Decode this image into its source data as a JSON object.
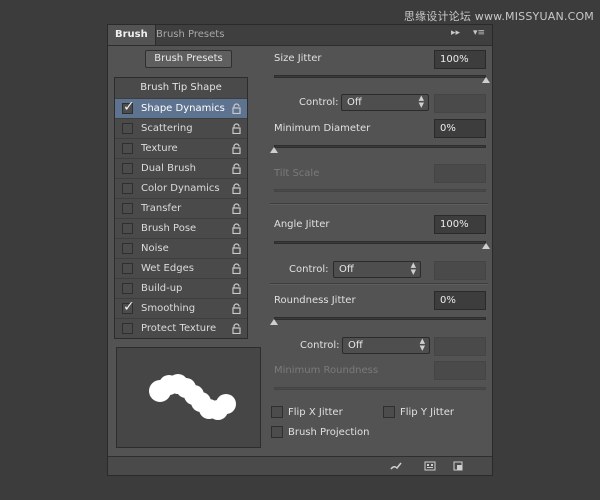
{
  "watermark": "思缘设计论坛 www.MISSYUAN.COM",
  "tabs": [
    "Brush",
    "Brush Presets"
  ],
  "tab_controls": {
    "collapse": "▸▸",
    "menu": "▾≡"
  },
  "presets_button": "Brush Presets",
  "list": {
    "header": "Brush Tip Shape",
    "items": [
      {
        "label": "Shape Dynamics",
        "checked": true,
        "selected": true
      },
      {
        "label": "Scattering",
        "checked": false
      },
      {
        "label": "Texture",
        "checked": false
      },
      {
        "label": "Dual Brush",
        "checked": false
      },
      {
        "label": "Color Dynamics",
        "checked": false
      },
      {
        "label": "Transfer",
        "checked": false
      },
      {
        "label": "Brush Pose",
        "checked": false
      },
      {
        "label": "Noise",
        "checked": false
      },
      {
        "label": "Wet Edges",
        "checked": false
      },
      {
        "label": "Build-up",
        "checked": false
      },
      {
        "label": "Smoothing",
        "checked": true
      },
      {
        "label": "Protect Texture",
        "checked": false
      }
    ]
  },
  "settings": {
    "size_jitter": {
      "label": "Size Jitter",
      "value": "100%",
      "slider_fraction": 1.0
    },
    "size_control": {
      "label": "Control:",
      "value": "Off"
    },
    "minimum_diameter": {
      "label": "Minimum Diameter",
      "value": "0%",
      "slider_fraction": 0.0
    },
    "tilt_scale": {
      "label": "Tilt Scale"
    },
    "angle_jitter": {
      "label": "Angle Jitter",
      "value": "100%",
      "slider_fraction": 1.0
    },
    "angle_control": {
      "label": "Control:",
      "value": "Off"
    },
    "roundness_jitter": {
      "label": "Roundness Jitter",
      "value": "0%",
      "slider_fraction": 0.0
    },
    "roundness_control": {
      "label": "Control:",
      "value": "Off"
    },
    "minimum_roundness": {
      "label": "Minimum Roundness"
    },
    "flip_x": {
      "label": "Flip X Jitter",
      "checked": false
    },
    "flip_y": {
      "label": "Flip Y Jitter",
      "checked": false
    },
    "brush_projection": {
      "label": "Brush Projection",
      "checked": false
    }
  },
  "footer_icons": [
    "toggle-live-tip-brush-preview-icon",
    "open-preset-manager-icon",
    "create-new-brush-icon"
  ],
  "colors": {
    "selected_row": "#5e7390",
    "panel": "#535353",
    "background": "#3c3c3c"
  }
}
